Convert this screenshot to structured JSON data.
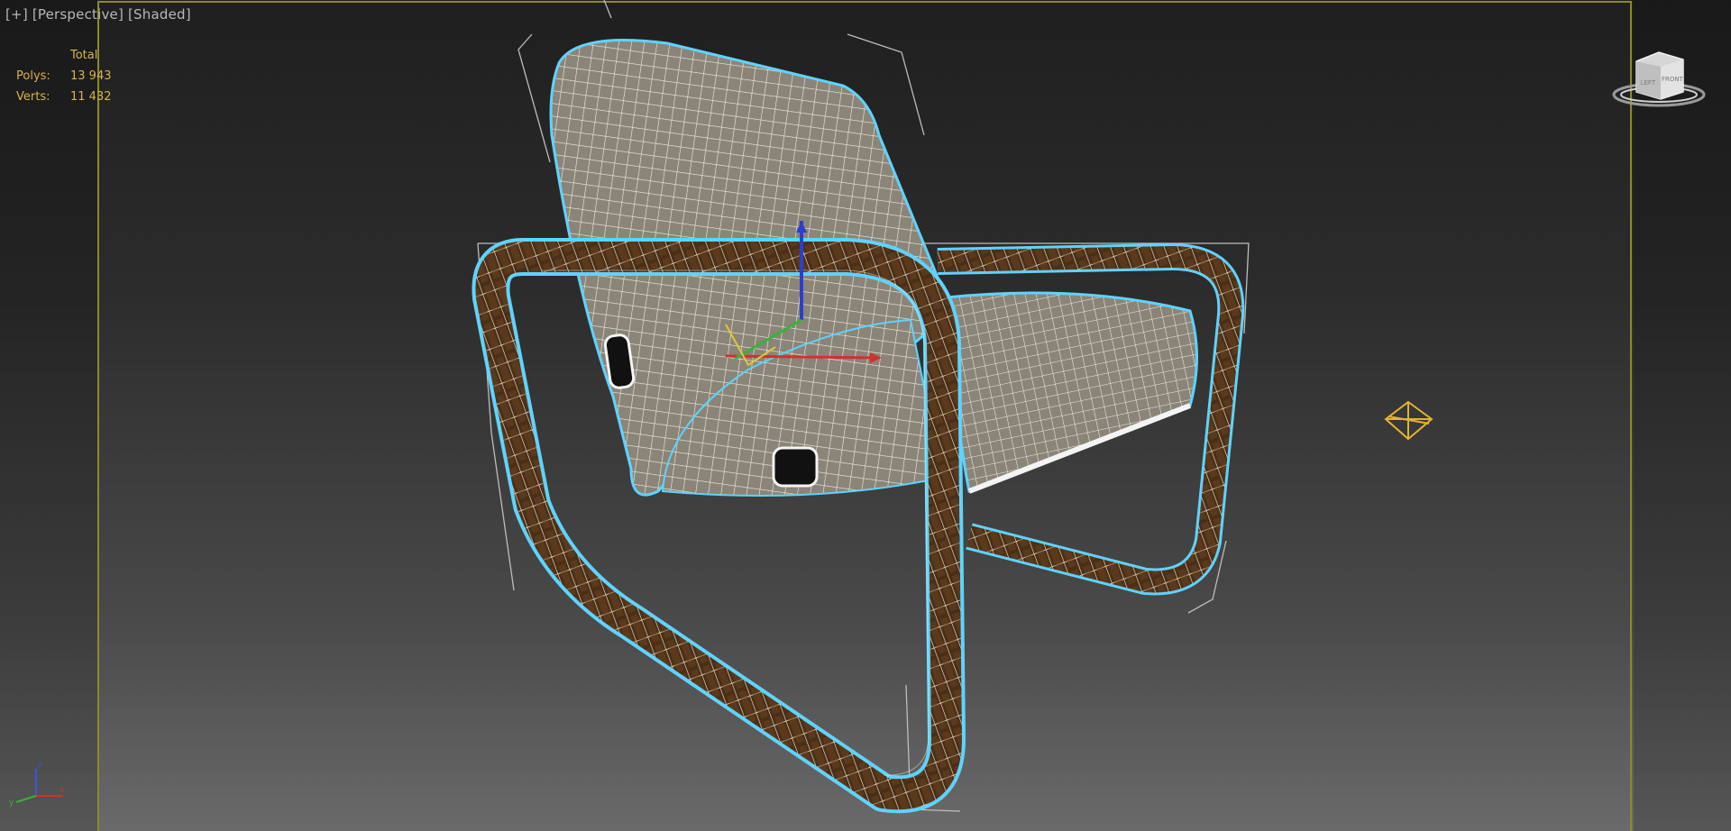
{
  "viewport": {
    "label_plus": "[+]",
    "label_view": "[Perspective]",
    "label_shading": "[Shaded]"
  },
  "stats": {
    "header": "Total",
    "polys_label": "Polys:",
    "polys_value": "13 943",
    "verts_label": "Verts:",
    "verts_value": "11 432"
  },
  "viewcube": {
    "front_face": "LEFT",
    "side_face": "FRONT"
  },
  "axes": {
    "x": "x",
    "y": "y",
    "z": "z"
  },
  "colors": {
    "frame_border": "#8c8a2a",
    "stats_text": "#d8b34a",
    "selection_outline": "#5fd3ff",
    "wood": "#5a3a1c",
    "wire": "#e8e4d8",
    "gizmo_light": "#e3b431"
  }
}
